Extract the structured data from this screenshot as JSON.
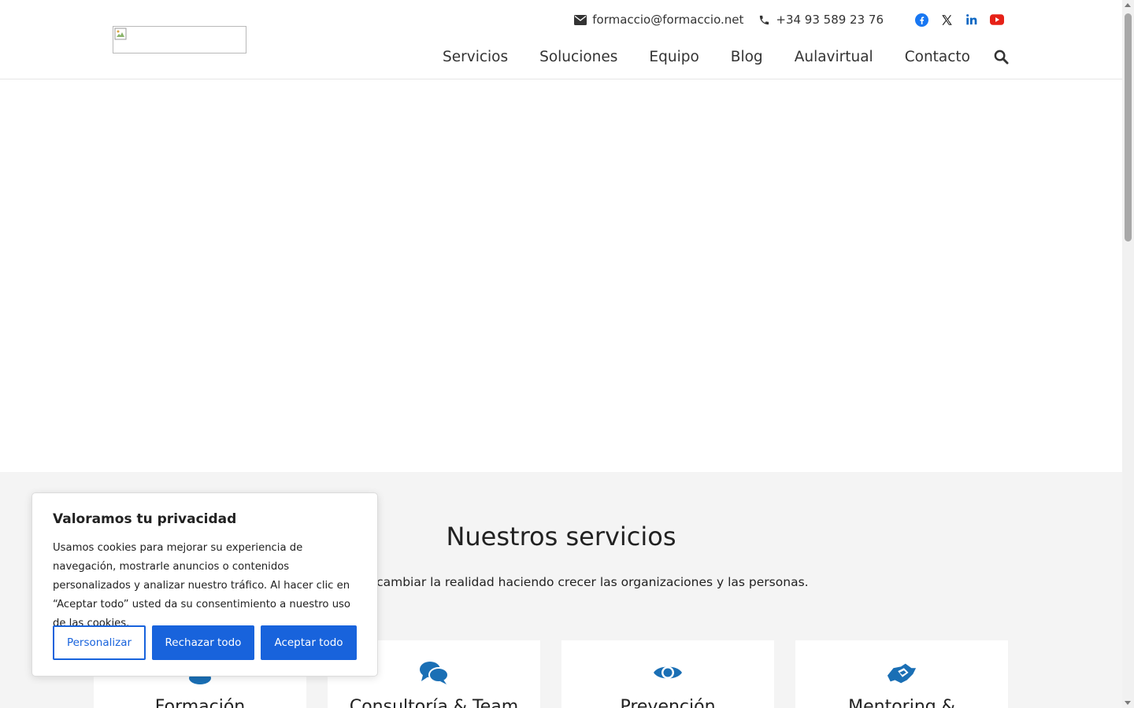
{
  "header": {
    "email": "formaccio@formaccio.net",
    "phone": "+34 93 589 23 76",
    "social": [
      {
        "name": "facebook-icon",
        "color": "#1877f2"
      },
      {
        "name": "x-icon",
        "color": "#111111"
      },
      {
        "name": "linkedin-icon",
        "color": "#0a66c2"
      },
      {
        "name": "youtube-icon",
        "color": "#e62117"
      }
    ],
    "nav": [
      {
        "label": "Servicios"
      },
      {
        "label": "Soluciones"
      },
      {
        "label": "Equipo"
      },
      {
        "label": "Blog"
      },
      {
        "label": "Aulavirtual"
      },
      {
        "label": "Contacto"
      }
    ]
  },
  "services": {
    "title": "Nuestros servicios",
    "subtitle": "yudarte a cambiar la realidad haciendo crecer las organizaciones y las personas.",
    "cards": [
      {
        "title": "Formación",
        "icon": "group-icon"
      },
      {
        "title": "Consultoría & Team",
        "icon": "comments-icon"
      },
      {
        "title": "Prevención",
        "icon": "eye-icon"
      },
      {
        "title": "Mentoring &",
        "icon": "handshake-icon"
      }
    ]
  },
  "cookie": {
    "title": "Valoramos tu privacidad",
    "text": "Usamos cookies para mejorar su experiencia de navegación, mostrarle anuncios o contenidos personalizados y analizar nuestro tráfico. Al hacer clic en “Aceptar todo” usted da su consentimiento a nuestro uso de las cookies.",
    "customize_label": "Personalizar",
    "reject_label": "Rechazar todo",
    "accept_label": "Aceptar todo"
  },
  "colors": {
    "accent": "#1863dc",
    "icon_blue": "#1a6fb5",
    "section_bg": "#f4f4f4"
  }
}
